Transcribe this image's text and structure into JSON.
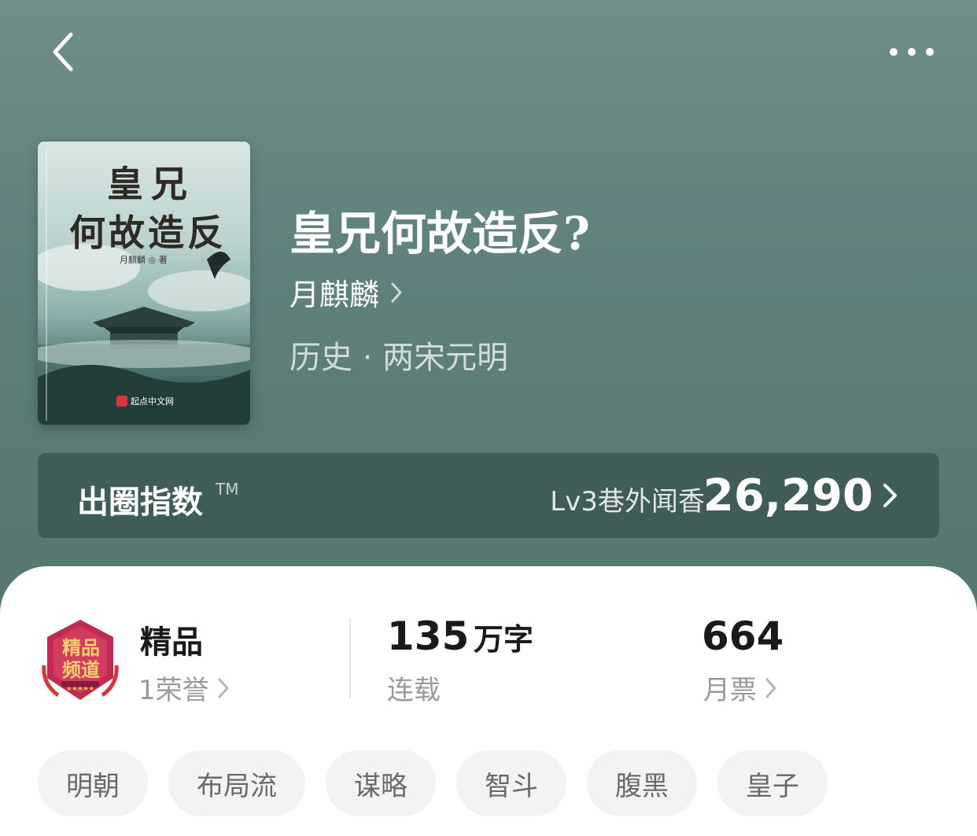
{
  "header": {
    "back_icon": "chevron-left-icon",
    "more_icon": "more-horizontal-icon"
  },
  "book": {
    "cover": {
      "title_line1": "皇兄",
      "title_line2": "何故造反",
      "author": "月麒麟 ◎ 著",
      "publisher": "起点中文网"
    },
    "title": "皇兄何故造反?",
    "author": "月麒麟",
    "genre": "历史 · 两宋元明"
  },
  "index": {
    "title": "出圈指数",
    "tm": "TM",
    "level": "Lv3巷外闻香",
    "value": "26,290"
  },
  "stats": {
    "badge": {
      "icon": "premium-channel-badge-icon",
      "badge_text": "精品频道",
      "name": "精品",
      "sub": "1荣誉"
    },
    "words": {
      "number": "135",
      "unit": "万字",
      "sub": "连载"
    },
    "tickets": {
      "number": "664",
      "sub": "月票"
    }
  },
  "tags": [
    "明朝",
    "布局流",
    "谋略",
    "智斗",
    "腹黑",
    "皇子"
  ],
  "colors": {
    "hero_bg": "#5f807c",
    "badge_red": "#c22a52",
    "tag_bg": "#f3f3f3"
  }
}
